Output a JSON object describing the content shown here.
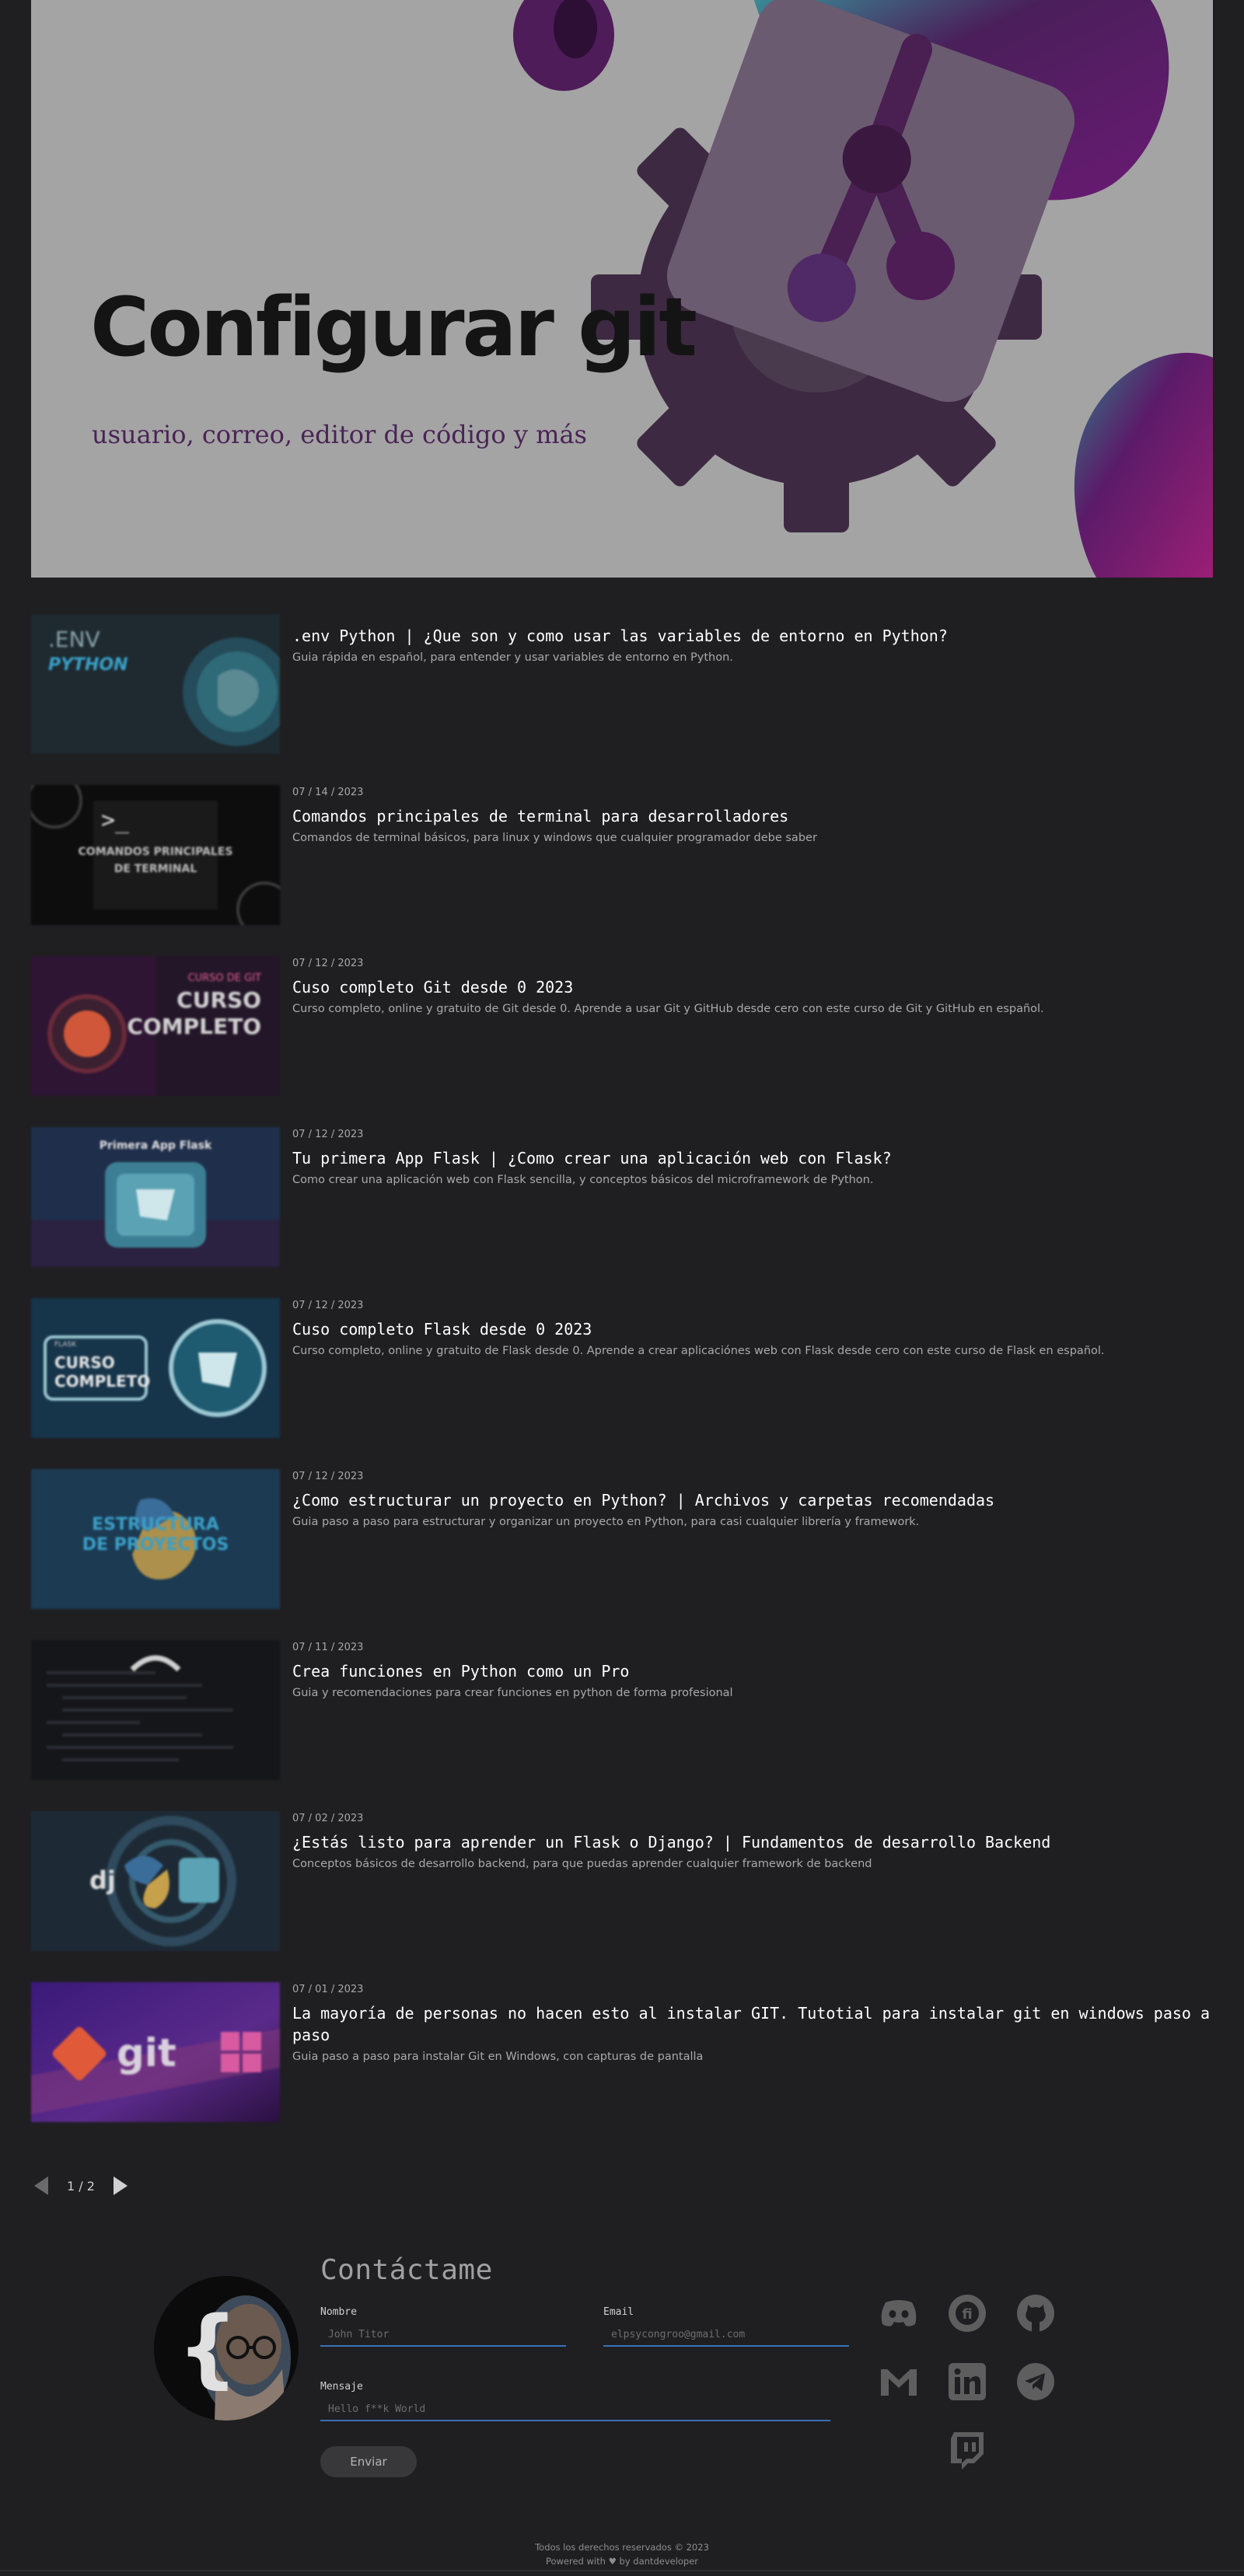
{
  "hero": {
    "title": "Configurar git",
    "subtitle": "usuario, correo, editor de código y más"
  },
  "posts": [
    {
      "date": "",
      "title": ".env Python | ¿Que son y como usar las variables de entorno en Python?",
      "description": "Guia rápida en español, para entender y usar variables de entorno en Python.",
      "thumb_text": [
        ".ENV",
        "PYTHON"
      ]
    },
    {
      "date": "07 / 14 / 2023",
      "title": "Comandos principales de terminal para desarrolladores",
      "description": "Comandos de terminal básicos, para linux y windows que cualquier programador debe saber",
      "thumb_text": [
        ">_",
        "COMANDOS PRINCIPALES",
        "DE TERMINAL"
      ]
    },
    {
      "date": "07 / 12 / 2023",
      "title": "Cuso completo Git desde 0 2023",
      "description": "Curso completo, online y gratuito de Git desde 0. Aprende a usar Git y GitHub desde cero con este curso de Git y GitHub en español.",
      "thumb_text": [
        "CURSO DE GIT",
        "CURSO",
        "COMPLETO"
      ]
    },
    {
      "date": "07 / 12 / 2023",
      "title": "Tu primera App Flask | ¿Como crear una aplicación web con Flask?",
      "description": "Como crear una aplicación web con Flask sencilla, y conceptos básicos del microframework de Python.",
      "thumb_text": [
        "Primera App Flask"
      ]
    },
    {
      "date": "07 / 12 / 2023",
      "title": "Cuso completo Flask desde 0 2023",
      "description": "Curso completo, online y gratuito de Flask desde 0. Aprende a crear aplicaciónes web con Flask desde cero con este curso de Flask en español.",
      "thumb_text": [
        "FLASK",
        "CURSO",
        "COMPLETO"
      ]
    },
    {
      "date": "07 / 12 / 2023",
      "title": "¿Como estructurar un proyecto en Python? | Archivos y carpetas recomendadas",
      "description": "Guia paso a paso para estructurar y organizar un proyecto en Python, para casi cualquier librería y framework.",
      "thumb_text": [
        "ESTRUCTURA",
        "DE PROYECTOS"
      ]
    },
    {
      "date": "07 / 11 / 2023",
      "title": "Crea funciones en Python como un Pro",
      "description": "Guia y recomendaciones para crear funciones en python de forma profesional",
      "thumb_text": []
    },
    {
      "date": "07 / 02 / 2023",
      "title": "¿Estás listo para aprender un Flask o Django? | Fundamentos de desarrollo Backend",
      "description": "Conceptos básicos de desarrollo backend, para que puedas aprender cualquier framework de backend",
      "thumb_text": [
        "dj"
      ]
    },
    {
      "date": "07 / 01 / 2023",
      "title": "La mayoría de personas no hacen esto al instalar GIT. Tutotial para instalar git en windows paso a paso",
      "description": "Guia paso a paso para instalar Git en Windows, con capturas de pantalla",
      "thumb_text": [
        "git"
      ]
    }
  ],
  "pagination": {
    "label": "1 / 2"
  },
  "contact": {
    "heading": "Contáctame",
    "name_label": "Nombre",
    "name_placeholder": "John Titor",
    "email_label": "Email",
    "email_placeholder": "elpsycongroo@gmail.com",
    "message_label": "Mensaje",
    "message_placeholder": "Hello f**k World",
    "send_label": "Enviar"
  },
  "socials": [
    "discord-icon",
    "hashnode-icon",
    "github-icon",
    "gmail-icon",
    "linkedin-icon",
    "telegram-icon",
    "twitch-icon"
  ],
  "footer": {
    "rights": "Todos los derechos reservados © 2023",
    "powered": "Powered with ♥ by dantdeveloper"
  },
  "colors": {
    "background": "#1f1f21",
    "hero_bg": "#a4a4a4",
    "accent_purple": "#5a1f63",
    "input_underline": "#3b6fb5"
  }
}
